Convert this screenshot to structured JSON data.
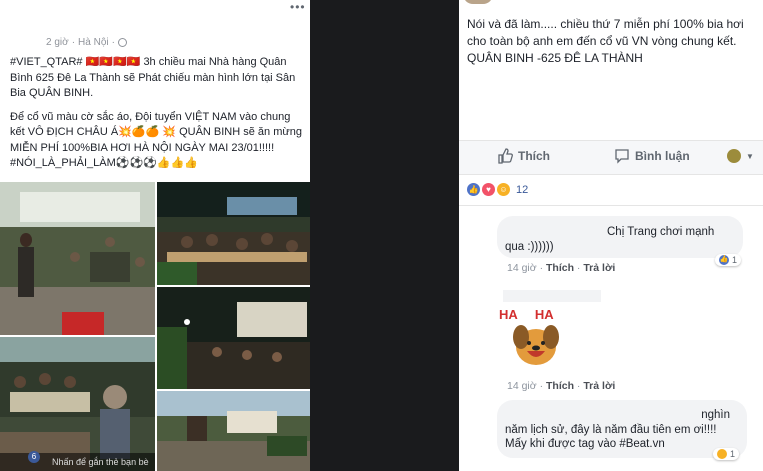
{
  "post": {
    "time": "2 giờ",
    "location": "Hà Nội",
    "paragraph1": "#VIET_QTAR# 🇻🇳🇻🇳🇻🇳🇻🇳 3h chiều mai Nhà hàng Quân Bình 625 Đê La Thành sẽ Phát chiếu màn hình lớn tại Sân Bia QUÂN BINH.",
    "paragraph2": "Để cổ vũ màu cờ sắc áo, Đội tuyển VIỆT NAM vào chung kết VÔ ĐỊCH CHÂU Á💥🍊🍊 💥 QUÂN BINH sẽ ăn mừng MIỄN PHÍ 100%BIA HƠI HÀ NỘI NGÀY MAI 23/01!!!!!",
    "paragraph3": "#NÓI_LÀ_PHẢI_LÀM⚽⚽⚽👍👍👍",
    "photo_tag_hint": "Nhấn để gắn thẻ bạn bè",
    "avatar_letter": "6"
  },
  "right_post": {
    "text": "Nói và đã làm..... chiều thứ 7 miễn phí 100% bia hơi cho toàn bộ anh em đến cổ vũ VN vòng chung kết. QUÂN BINH -625 ĐÊ LA THÀNH"
  },
  "actions": {
    "like": "Thích",
    "comment": "Bình luận"
  },
  "reactions": {
    "count": "12"
  },
  "comments": [
    {
      "text_line1": "Chị Trang chơi mạnh",
      "text_line2": "qua :))))))",
      "time": "14 giờ",
      "like": "Thích",
      "reply": "Trả lời",
      "like_count": "1"
    },
    {
      "sticker_text": "HA HA",
      "time": "14 giờ",
      "like": "Thích",
      "reply": "Trả lời"
    },
    {
      "text_line1": "nghìn",
      "text_line2": "năm lịch sử, đây là năm đầu tiên em ơi!!!!",
      "text_line3": "Mấy khi được tag vào #Beat.vn",
      "reaction_count": "1"
    }
  ]
}
